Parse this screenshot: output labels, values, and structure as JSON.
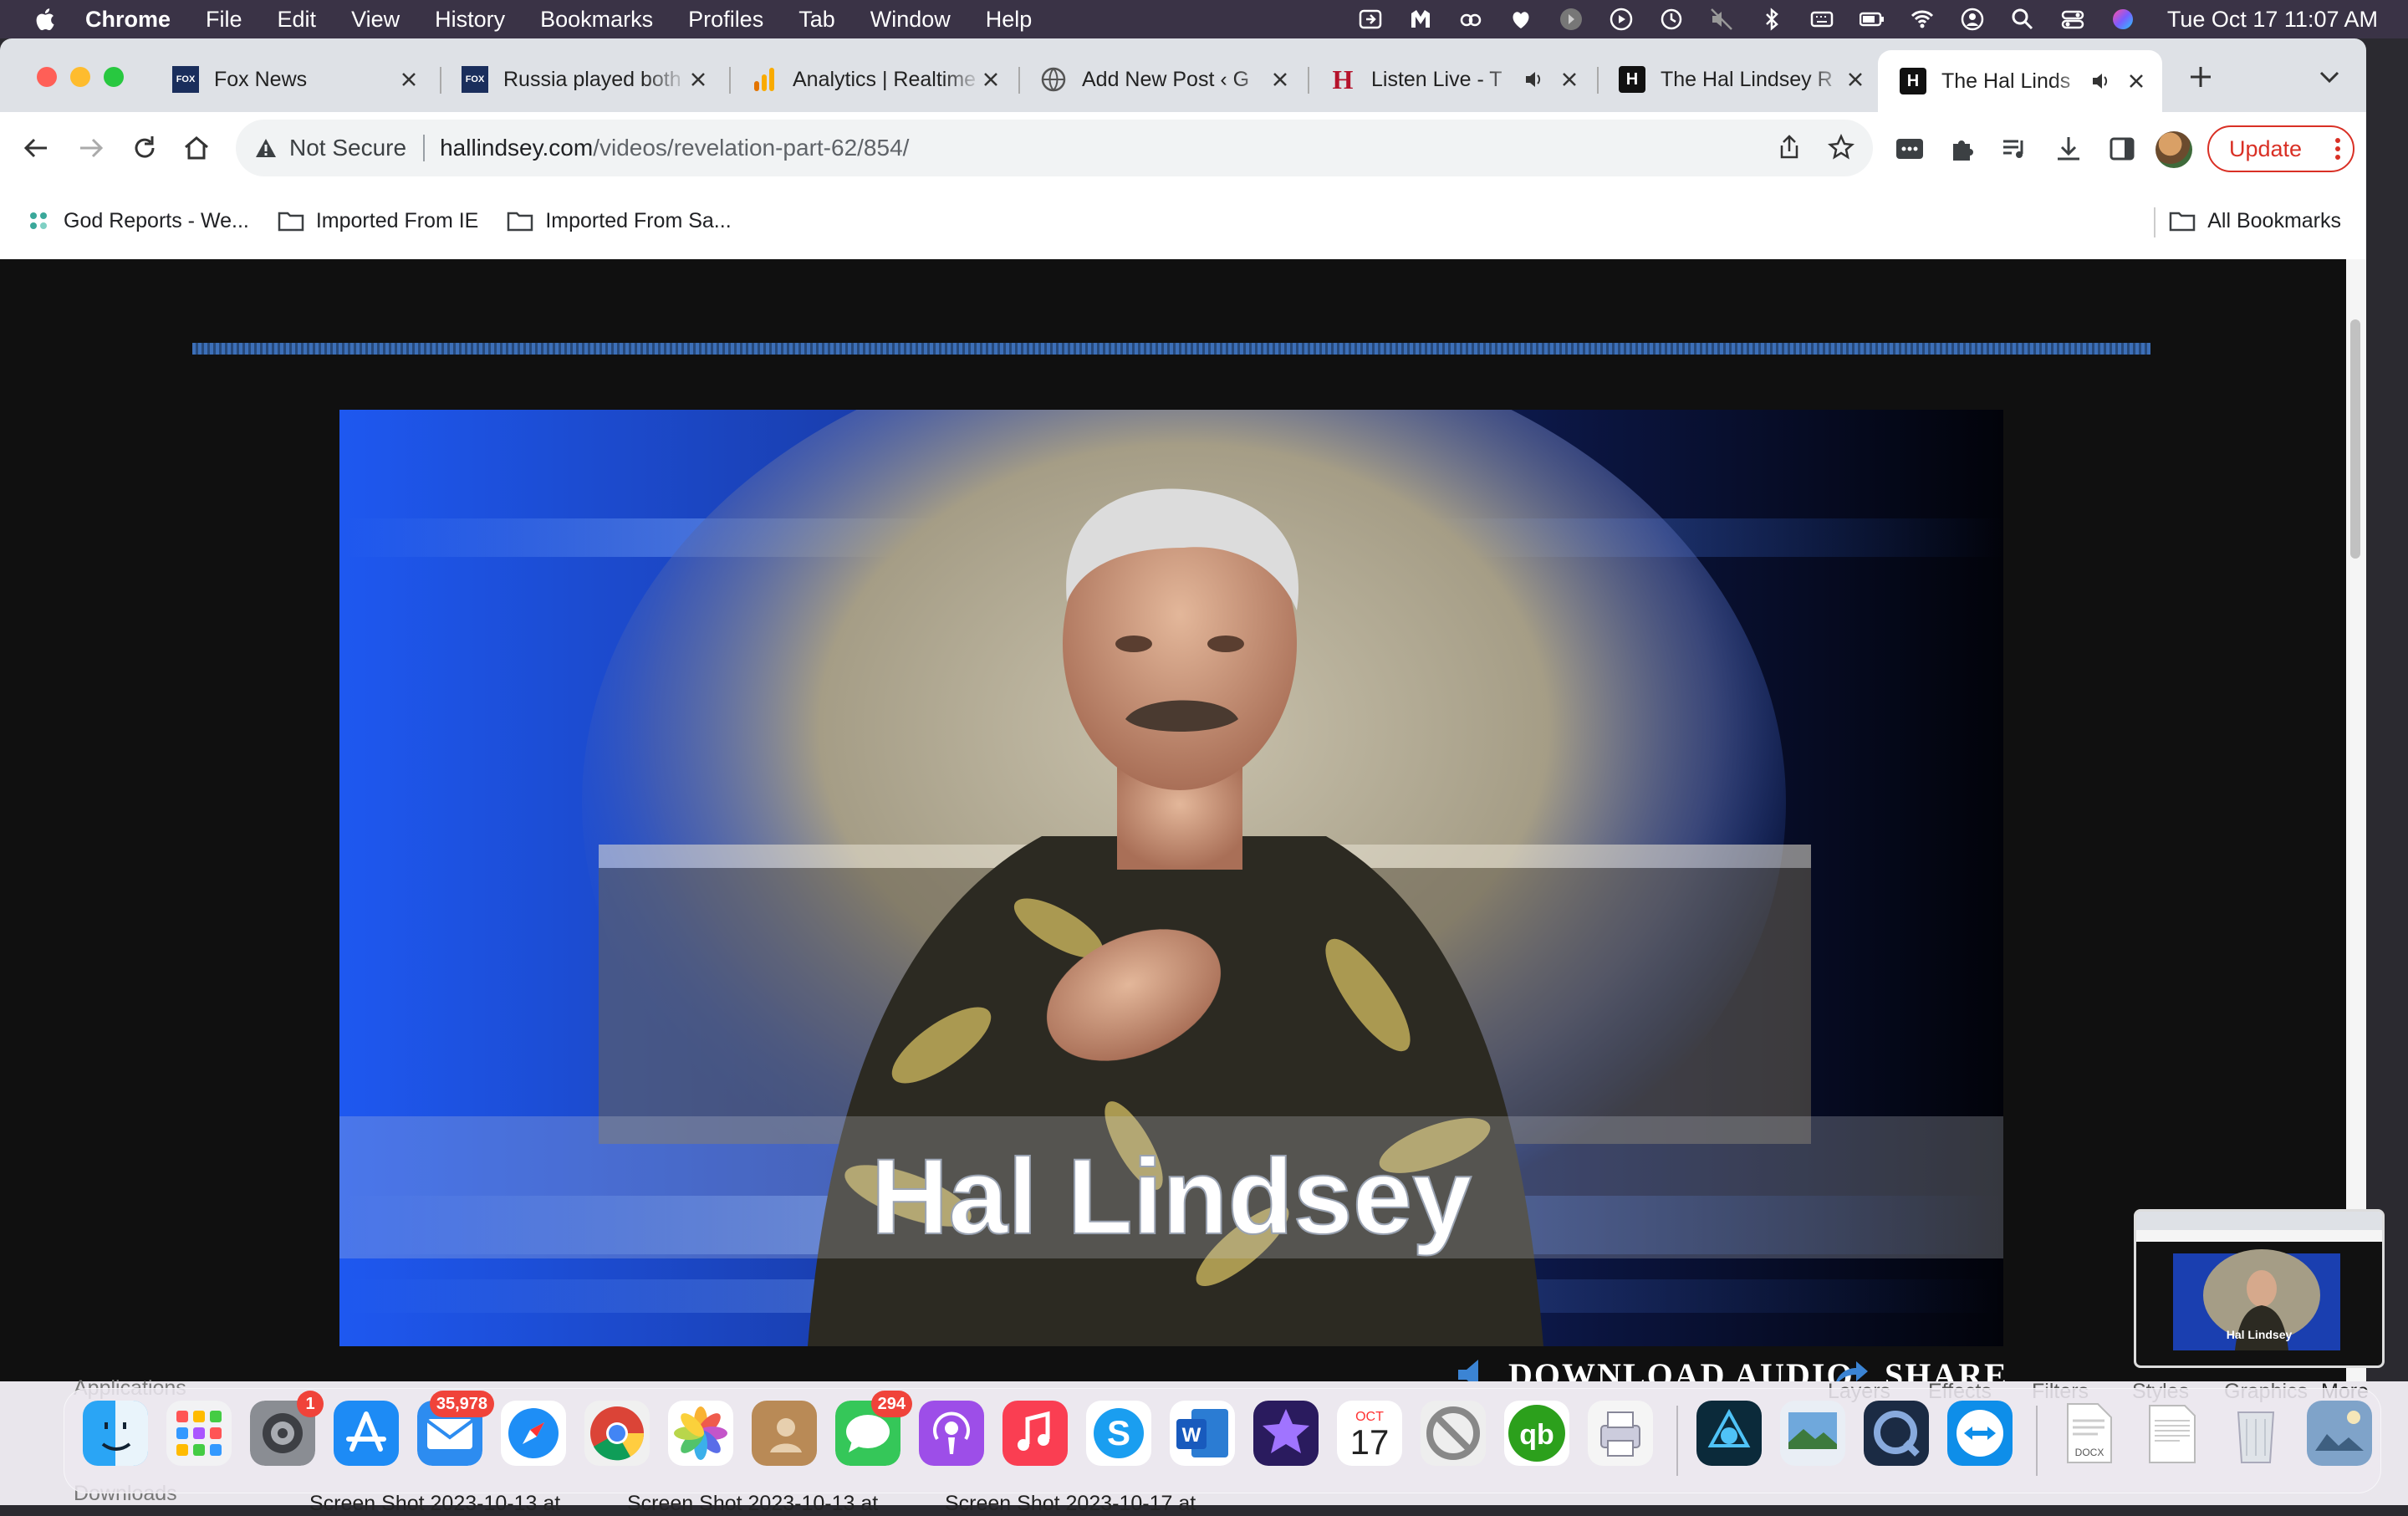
{
  "menubar": {
    "app": "Chrome",
    "items": [
      "File",
      "Edit",
      "View",
      "History",
      "Bookmarks",
      "Profiles",
      "Tab",
      "Window",
      "Help"
    ],
    "clock": "Tue Oct 17  11:07 AM"
  },
  "tabs": [
    {
      "title": "Fox News",
      "favicon": "fox-news-icon"
    },
    {
      "title": "Russia played both",
      "favicon": "fox-news-icon"
    },
    {
      "title": "Analytics | Realtime",
      "favicon": "analytics-icon"
    },
    {
      "title": "Add New Post ‹ G",
      "favicon": "globe-icon"
    },
    {
      "title": "Listen Live - T",
      "favicon": "h-icon",
      "audio": true
    },
    {
      "title": "The Hal Lindsey R",
      "favicon": "h-icon"
    },
    {
      "title": "The Hal Linds",
      "favicon": "h-icon",
      "audio": true,
      "active": true
    }
  ],
  "address": {
    "security": "Not Secure",
    "host": "hallindsey.com",
    "path": "/videos/revelation-part-62/854/"
  },
  "update_label": "Update",
  "bookmarks": {
    "items": [
      "God Reports - We...",
      "Imported From IE",
      "Imported From Sa..."
    ],
    "all": "All Bookmarks"
  },
  "video": {
    "overlay_title": "Hal Lindsey"
  },
  "below_video": {
    "download_audio": "DOWNLOAD AUDIO",
    "share": "SHARE"
  },
  "pip": {
    "label": "Hal Lindsey"
  },
  "desktop": {
    "sidebar_items": [
      "Applications",
      "Downloads"
    ],
    "files": [
      "Screen Shot 2023-10-13 at",
      "Screen Shot 2023-10-13 at",
      "Screen Shot 2023-10-17 at"
    ],
    "app_menu": [
      "Layers",
      "Effects",
      "Filters",
      "Styles",
      "Graphics",
      "More"
    ]
  },
  "dock": {
    "badges": {
      "settings": "1",
      "mail": "35,978",
      "messages": "294"
    },
    "calendar": {
      "month": "OCT",
      "day": "17"
    },
    "docx_label": "DOCX"
  },
  "colors": {
    "menubar": "#3a3346",
    "tabstrip": "#dee1e6",
    "update_red": "#d93025",
    "badge_red": "#f0433a",
    "video_blue": "#1d4fd6"
  }
}
